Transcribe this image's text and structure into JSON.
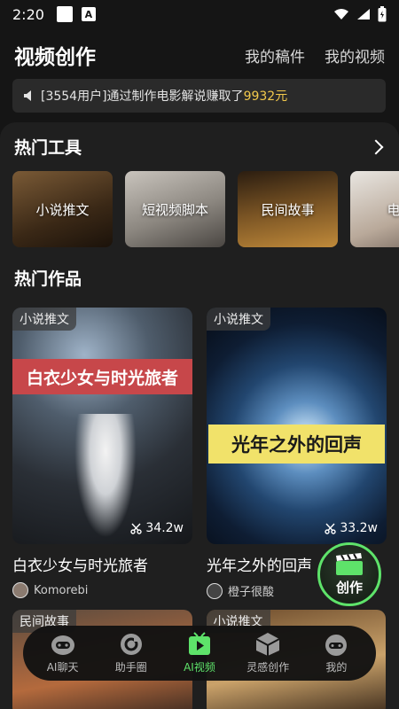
{
  "status_bar": {
    "time": "2:20"
  },
  "header": {
    "title": "视频创作",
    "links": [
      "我的稿件",
      "我的视频"
    ]
  },
  "notice": {
    "prefix": "[3554用户]通过制作电影解说赚取了",
    "amount": "9932元"
  },
  "hot_tools": {
    "title": "热门工具",
    "items": [
      "小说推文",
      "短视频脚本",
      "民间故事",
      "电影"
    ]
  },
  "hot_works": {
    "title": "热门作品",
    "items": [
      {
        "tag": "小说推文",
        "banner": "白衣少女与时光旅者",
        "count": "34.2w",
        "title": "白衣少女与时光旅者",
        "author": "Komorebi"
      },
      {
        "tag": "小说推文",
        "banner": "光年之外的回声",
        "count": "33.2w",
        "title": "光年之外的回声",
        "author": "橙子很酸"
      }
    ],
    "row2_tags": [
      "民间故事",
      "小说推文"
    ]
  },
  "create_button": {
    "label": "创作"
  },
  "tabbar": {
    "items": [
      {
        "label": "AI聊天",
        "icon": "robot-icon"
      },
      {
        "label": "助手圈",
        "icon": "circle-icon"
      },
      {
        "label": "AI视频",
        "icon": "video-play-icon"
      },
      {
        "label": "灵感创作",
        "icon": "cube-icon"
      },
      {
        "label": "我的",
        "icon": "profile-robot-icon"
      }
    ],
    "active": "AI视频"
  },
  "colors": {
    "accent": "#5ee36a",
    "highlight": "#f2c94c",
    "background": "#151515"
  }
}
